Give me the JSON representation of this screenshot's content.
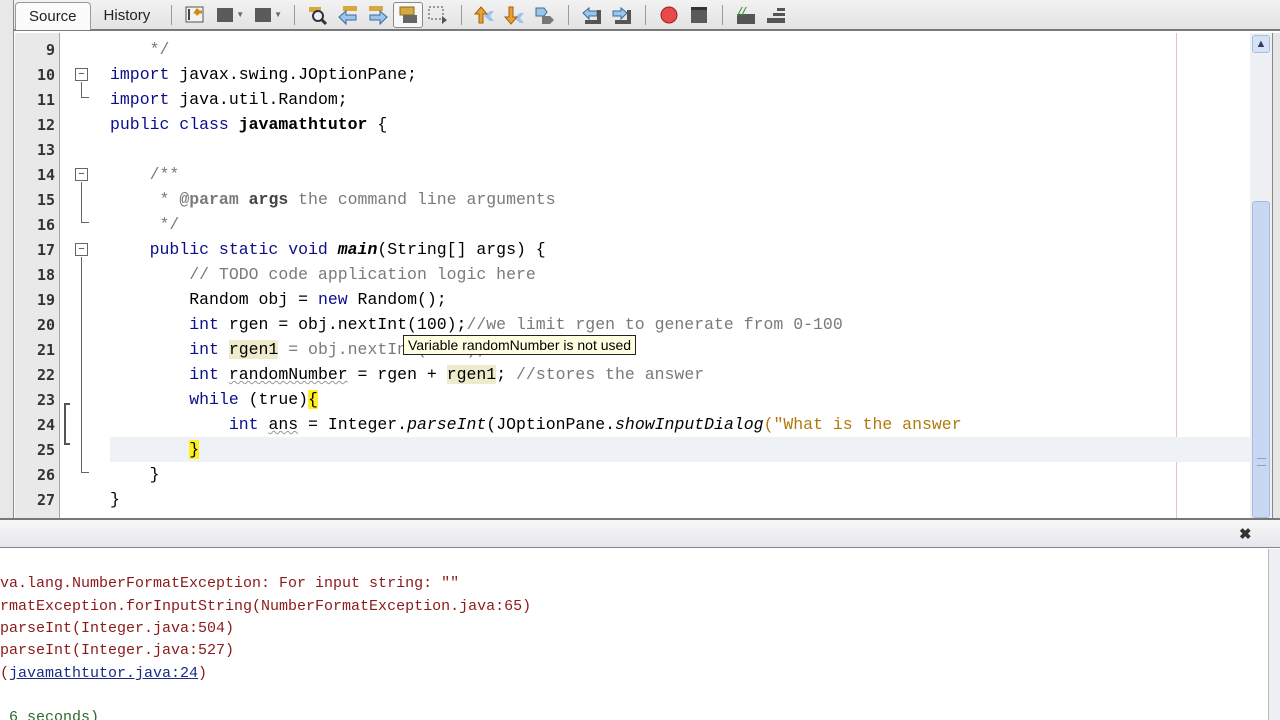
{
  "toolbar": {
    "tabs": [
      {
        "label": "Source",
        "active": true
      },
      {
        "label": "History",
        "active": false
      }
    ],
    "buttons": [
      "last-edit-icon",
      "back-icon",
      "forward-icon",
      "find-selection-icon",
      "find-previous-icon",
      "find-next-icon",
      "toggle-highlight-icon",
      "rectangular-selection-icon",
      "previous-bookmark-icon",
      "next-bookmark-icon",
      "toggle-bookmark-icon",
      "shift-left-icon",
      "shift-right-icon",
      "start-macro-icon",
      "stop-macro-icon",
      "comment-icon",
      "uncomment-icon"
    ]
  },
  "editor": {
    "lines": [
      {
        "n": "9"
      },
      {
        "n": "10"
      },
      {
        "n": "11"
      },
      {
        "n": "12"
      },
      {
        "n": "13"
      },
      {
        "n": "14"
      },
      {
        "n": "15"
      },
      {
        "n": "16"
      },
      {
        "n": "17"
      },
      {
        "n": "18"
      },
      {
        "n": "19"
      },
      {
        "n": "20"
      },
      {
        "n": "21"
      },
      {
        "n": "22"
      },
      {
        "n": "23"
      },
      {
        "n": "24"
      },
      {
        "n": "25"
      },
      {
        "n": "26"
      },
      {
        "n": "27"
      }
    ],
    "code": {
      "l9": "    */",
      "l10_kw": "import",
      "l10_rest": " javax.swing.JOptionPane;",
      "l11_kw": "import",
      "l11_rest": " java.util.Random;",
      "l12_kw": "public class",
      "l12_name": "javamathtutor",
      "l12_rest": " {",
      "l14": "    /**",
      "l15_a": "     * ",
      "l15_tag": "@param",
      "l15_arg": "args",
      "l15_rest": " the command line arguments",
      "l16": "     */",
      "l17_kw": "    public static void ",
      "l17_main": "main",
      "l17_rest": "(String[] args) {",
      "l18": "        // TODO code application logic here",
      "l19_a": "        Random obj = ",
      "l19_kw": "new",
      "l19_rest": " Random();",
      "l20_kw": "        int",
      "l20_rest": " rgen = obj.nextInt(100);",
      "l20_cm": "//we limit rgen to generate from 0-100",
      "l21_kw": "        int",
      "l21_var": "rgen1",
      "l21_rest": " = obj.nextInt(1000); // 0-1000",
      "l22_kw": "        int",
      "l22_var": "randomNumber",
      "l22_mid": " = rgen + ",
      "l22_var2": "rgen1",
      "l22_semi": ";",
      "l22_cm": " //stores the answer",
      "l23_kw": "        while",
      "l23_mid": " (true)",
      "l23_brace": "{",
      "l24_kw": "            int",
      "l24_var": "ans",
      "l24_mid": " = Integer.",
      "l24_m1": "parseInt",
      "l24_mid2": "(JOptionPane.",
      "l24_m2": "showInputDialog",
      "l24_str": "(\"What is the answer",
      "l25_brace": "}",
      "l26": "    }",
      "l27": "}"
    },
    "tooltip": "Variable randomNumber is not used"
  },
  "output": {
    "close_label": "✖",
    "lines": [
      "va.lang.NumberFormatException: For input string: \"\"",
      "rmatException.forInputString(NumberFormatException.java:65)",
      "parseInt(Integer.java:504)",
      "parseInt(Integer.java:527)"
    ],
    "trace_prefix": "(",
    "trace_link": "javamathtutor.java:24",
    "trace_suffix": ")",
    "build_time": " 6 seconds)"
  }
}
